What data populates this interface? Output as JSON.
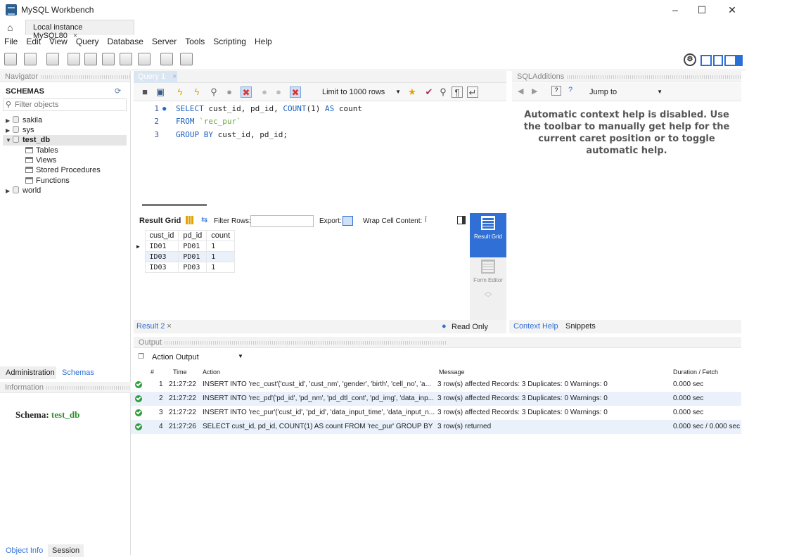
{
  "window": {
    "title": "MySQL Workbench",
    "minimize": "–",
    "maximize": "☐",
    "close": "✕"
  },
  "connection_tab": {
    "label": "Local instance MySQL80",
    "close": "×"
  },
  "menu": [
    "File",
    "Edit",
    "View",
    "Query",
    "Database",
    "Server",
    "Tools",
    "Scripting",
    "Help"
  ],
  "navigator": {
    "title": "Navigator",
    "schemas_title": "SCHEMAS",
    "filter_placeholder": "Filter objects",
    "schemas": [
      "sakila",
      "sys",
      "test_db",
      "world"
    ],
    "test_db_children": [
      "Tables",
      "Views",
      "Stored Procedures",
      "Functions"
    ],
    "bottom_tabs": [
      "Administration",
      "Schemas"
    ],
    "information_title": "Information",
    "schema_label": "Schema:",
    "schema_value": "test_db",
    "object_tabs": [
      "Object Info",
      "Session"
    ]
  },
  "query": {
    "tab_label": "Query 1",
    "tab_close": "×",
    "limit_label": "Limit to 1000 rows",
    "lines": [
      {
        "num": "1",
        "parts": [
          {
            "t": "SELECT",
            "c": "kw"
          },
          {
            "t": " cust_id, pd_id, ",
            "c": ""
          },
          {
            "t": "COUNT",
            "c": "kw"
          },
          {
            "t": "(1) ",
            "c": ""
          },
          {
            "t": "AS",
            "c": "kw"
          },
          {
            "t": " count",
            "c": ""
          }
        ]
      },
      {
        "num": "2",
        "parts": [
          {
            "t": "FROM",
            "c": "kw"
          },
          {
            "t": " `rec_pur`",
            "c": "str"
          }
        ]
      },
      {
        "num": "3",
        "parts": [
          {
            "t": "GROUP BY",
            "c": "kw"
          },
          {
            "t": " cust_id, pd_id;",
            "c": ""
          }
        ]
      }
    ]
  },
  "result": {
    "grid_label": "Result Grid",
    "filter_label": "Filter Rows:",
    "export_label": "Export:",
    "wrap_label": "Wrap Cell Content:",
    "columns": [
      "cust_id",
      "pd_id",
      "count"
    ],
    "rows": [
      [
        "ID01",
        "PD01",
        "1"
      ],
      [
        "ID03",
        "PD01",
        "1"
      ],
      [
        "ID03",
        "PD03",
        "1"
      ]
    ],
    "side_result": "Result Grid",
    "side_form": "Form Editor",
    "tab_label": "Result 2",
    "read_only": "Read Only"
  },
  "sql_additions": {
    "title": "SQLAdditions",
    "jump_to": "Jump to",
    "help_text": "Automatic context help is disabled. Use the toolbar to manually get help for the current caret position or to toggle automatic help.",
    "tabs": [
      "Context Help",
      "Snippets"
    ]
  },
  "output": {
    "title": "Output",
    "selector": "Action Output",
    "headers": [
      "#",
      "Time",
      "Action",
      "Message",
      "Duration / Fetch"
    ],
    "rows": [
      {
        "n": "1",
        "time": "21:27:22",
        "action": "INSERT INTO 'rec_cust'('cust_id', 'cust_nm', 'gender', 'birth', 'cell_no', 'a...",
        "message": "3 row(s) affected Records: 3  Duplicates: 0  Warnings: 0",
        "duration": "0.000 sec"
      },
      {
        "n": "2",
        "time": "21:27:22",
        "action": "INSERT INTO 'rec_pd'('pd_id', 'pd_nm', 'pd_dtl_cont', 'pd_img', 'data_inp...",
        "message": "3 row(s) affected Records: 3  Duplicates: 0  Warnings: 0",
        "duration": "0.000 sec"
      },
      {
        "n": "3",
        "time": "21:27:22",
        "action": "INSERT INTO 'rec_pur'('cust_id', 'pd_id', 'data_input_time', 'data_input_n...",
        "message": "3 row(s) affected Records: 3  Duplicates: 0  Warnings: 0",
        "duration": "0.000 sec"
      },
      {
        "n": "4",
        "time": "21:27:26",
        "action": "SELECT cust_id, pd_id, COUNT(1) AS count FROM 'rec_pur' GROUP BY ...",
        "message": "3 row(s) returned",
        "duration": "0.000 sec / 0.000 sec"
      }
    ]
  },
  "colors": {
    "accent": "#2f6fd6",
    "ok": "#2e9b3c",
    "schema_green": "#2a8f2a"
  }
}
